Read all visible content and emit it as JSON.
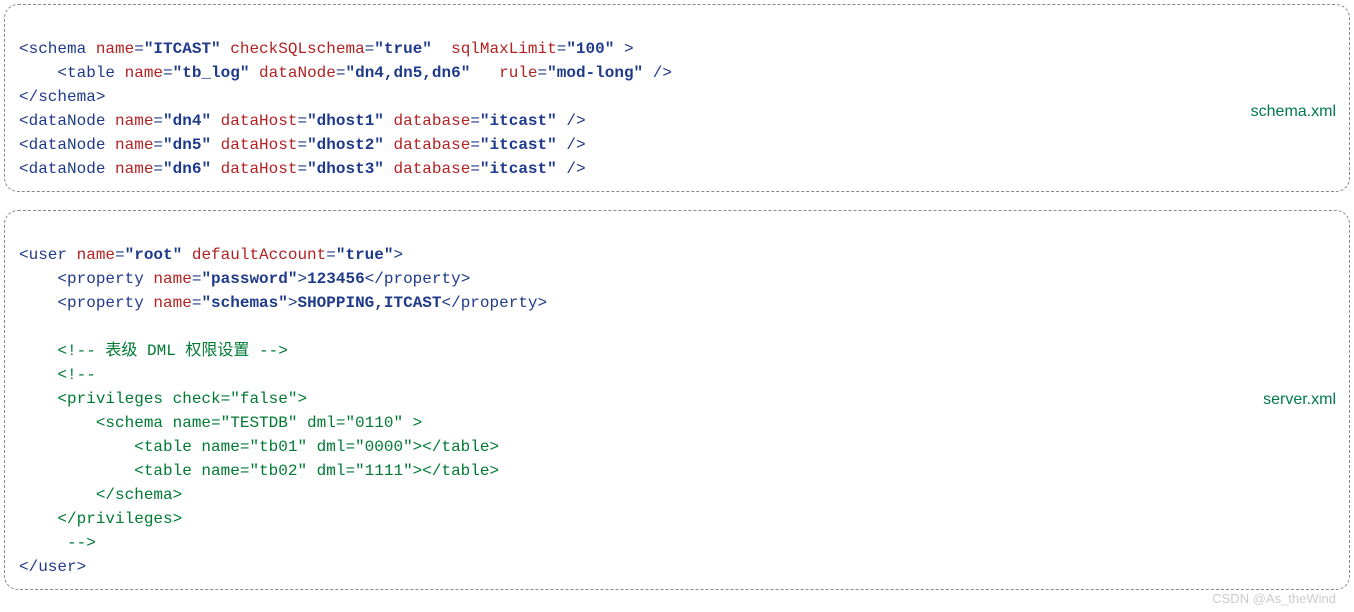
{
  "labels": {
    "schema": "schema.xml",
    "server": "server.xml"
  },
  "watermark": "CSDN @As_theWind",
  "schema": {
    "l1_a": "<schema ",
    "l1_b": "name",
    "l1_c": "=",
    "l1_d": "\"ITCAST\"",
    "l1_e": " checkSQLschema",
    "l1_f": "=",
    "l1_g": "\"true\"",
    "l1_h": "  sqlMaxLimit",
    "l1_i": "=",
    "l1_j": "\"100\"",
    "l1_k": " >",
    "l2_a": "    <table ",
    "l2_b": "name",
    "l2_c": "=",
    "l2_d": "\"tb_log\"",
    "l2_e": " dataNode",
    "l2_f": "=",
    "l2_g": "\"dn4,dn5,dn6\"",
    "l2_h": "   rule",
    "l2_i": "=",
    "l2_j": "\"mod-long\"",
    "l2_k": " />",
    "l3": "</schema>",
    "dn": [
      {
        "a": "<dataNode ",
        "b": "name",
        "c": "=",
        "d": "\"dn4\"",
        "e": " dataHost",
        "f": "=",
        "g": "\"dhost1\"",
        "h": " database",
        "i": "=",
        "j": "\"itcast\"",
        "k": " />"
      },
      {
        "a": "<dataNode ",
        "b": "name",
        "c": "=",
        "d": "\"dn5\"",
        "e": " dataHost",
        "f": "=",
        "g": "\"dhost2\"",
        "h": " database",
        "i": "=",
        "j": "\"itcast\"",
        "k": " />"
      },
      {
        "a": "<dataNode ",
        "b": "name",
        "c": "=",
        "d": "\"dn6\"",
        "e": " dataHost",
        "f": "=",
        "g": "\"dhost3\"",
        "h": " database",
        "i": "=",
        "j": "\"itcast\"",
        "k": " />"
      }
    ]
  },
  "server": {
    "l1_a": "<user ",
    "l1_b": "name",
    "l1_c": "=",
    "l1_d": "\"root\"",
    "l1_e": " defaultAccount",
    "l1_f": "=",
    "l1_g": "\"true\"",
    "l1_h": ">",
    "l2_a": "    <property ",
    "l2_b": "name",
    "l2_c": "=",
    "l2_d": "\"password\"",
    "l2_e": ">",
    "l2_f": "123456",
    "l2_g": "</property>",
    "l3_a": "    <property ",
    "l3_b": "name",
    "l3_c": "=",
    "l3_d": "\"schemas\"",
    "l3_e": ">",
    "l3_f": "SHOPPING,ITCAST",
    "l3_g": "</property>",
    "blank": "",
    "c1": "    <!-- 表级 DML 权限设置 -->",
    "c2": "    <!--",
    "c3": "    <privileges check=\"false\">",
    "c4": "        <schema name=\"TESTDB\" dml=\"0110\" >",
    "c5": "            <table name=\"tb01\" dml=\"0000\"></table>",
    "c6": "            <table name=\"tb02\" dml=\"1111\"></table>",
    "c7": "        </schema>",
    "c8": "    </privileges>",
    "c9": "     -->",
    "end": "</user>"
  }
}
